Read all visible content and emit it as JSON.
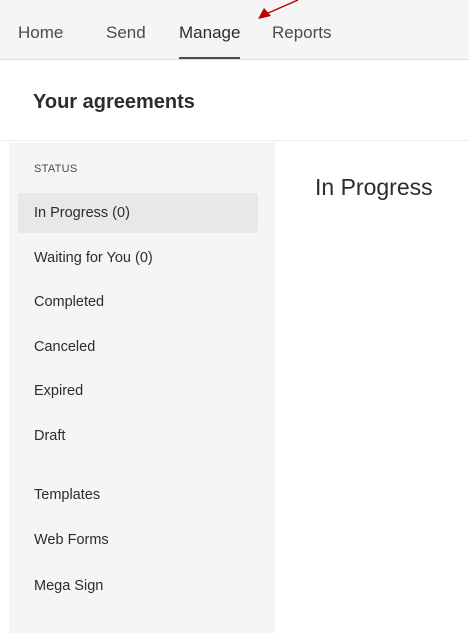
{
  "nav": {
    "tabs": [
      {
        "label": "Home"
      },
      {
        "label": "Send"
      },
      {
        "label": "Manage"
      },
      {
        "label": "Reports"
      }
    ],
    "active_tab": "Manage"
  },
  "header": {
    "title": "Your agreements"
  },
  "sidebar": {
    "heading": "STATUS",
    "status_items": [
      {
        "label": "In Progress (0)"
      },
      {
        "label": "Waiting for You (0)"
      },
      {
        "label": "Completed"
      },
      {
        "label": "Canceled"
      },
      {
        "label": "Expired"
      },
      {
        "label": "Draft"
      }
    ],
    "other_items": [
      {
        "label": "Templates"
      },
      {
        "label": "Web Forms"
      },
      {
        "label": "Mega Sign"
      }
    ],
    "selected_item": "In Progress (0)"
  },
  "main": {
    "title": "In Progress"
  },
  "colors": {
    "annotation_arrow": "#c00000",
    "nav_background": "#f5f5f5",
    "sidebar_background": "#f5f5f5",
    "selected_item_background": "#e8e8e8"
  }
}
